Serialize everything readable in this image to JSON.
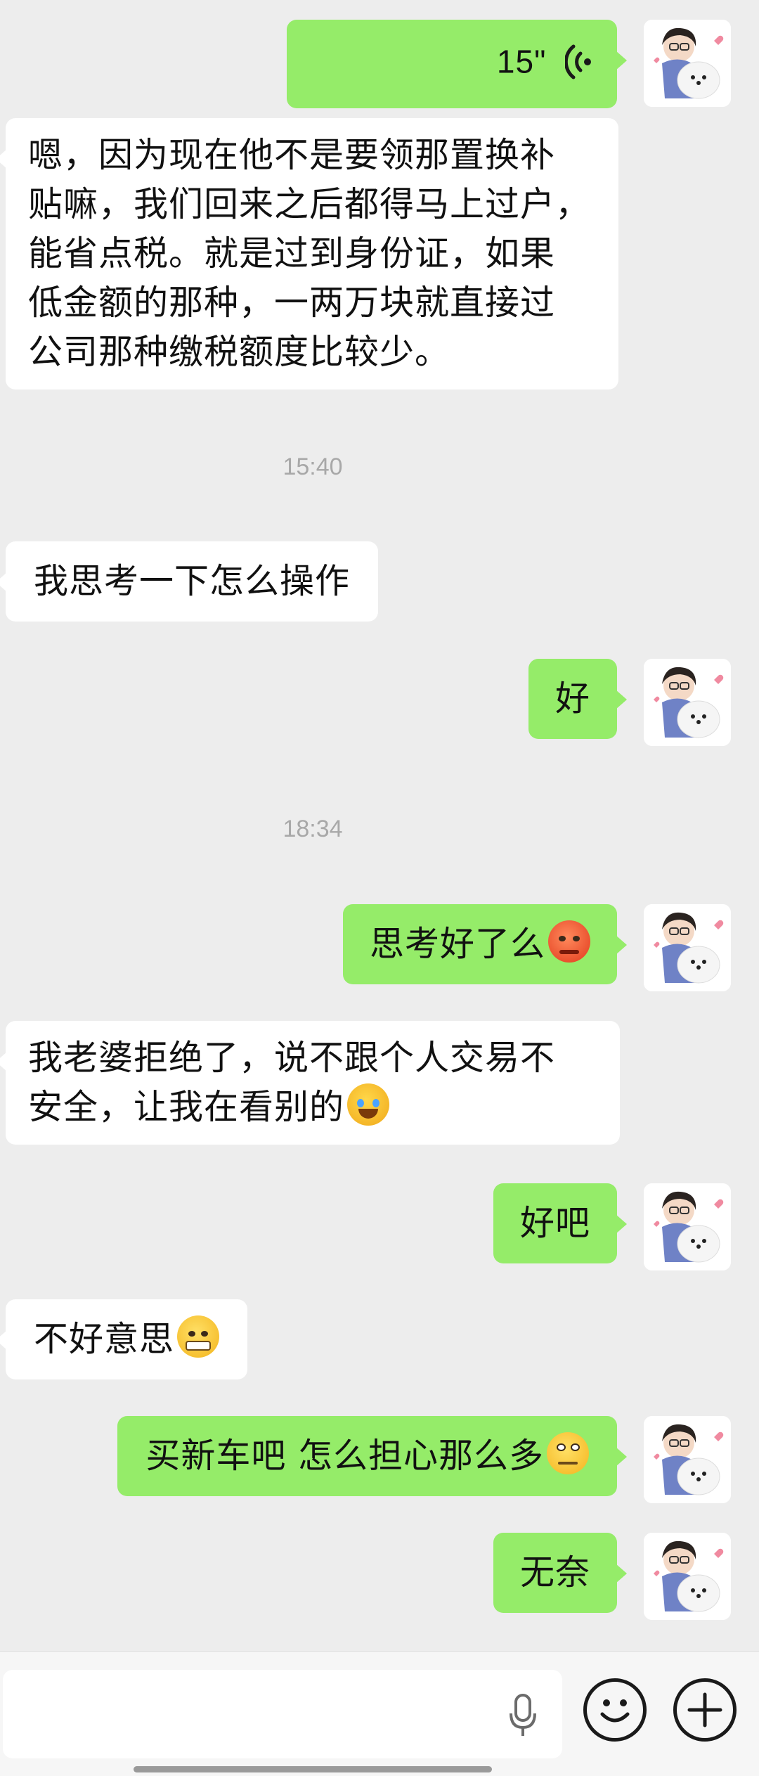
{
  "messages": [
    {
      "side": "out",
      "type": "voice",
      "duration": "15\""
    },
    {
      "side": "in",
      "text": [
        "嗯，因为现在他不是要领那置换补",
        "贴嘛，我们回来之后都得马上过户，",
        "能省点税。就是过到身份证，如果",
        "低金额的那种，一两万块就直接过",
        "公司那种缴税额度比较少。"
      ]
    },
    {
      "side": "time",
      "text": "15:40"
    },
    {
      "side": "in",
      "text": "我思考一下怎么操作"
    },
    {
      "side": "out",
      "text": "好"
    },
    {
      "side": "time",
      "text": "18:34"
    },
    {
      "side": "out",
      "text": "思考好了么",
      "emoji": "angry-sweat-emoji"
    },
    {
      "side": "in",
      "text": [
        "我老婆拒绝了，说不跟个人交易不",
        "安全，让我在看别的"
      ],
      "emoji": "crying-laughing-emoji"
    },
    {
      "side": "out",
      "text": "好吧"
    },
    {
      "side": "in",
      "text": "不好意思",
      "emoji": "grimacing-emoji"
    },
    {
      "side": "out",
      "text": "买新车吧 怎么担心那么多",
      "emoji": "eye-roll-sweat-emoji"
    },
    {
      "side": "out",
      "text": "无奈"
    }
  ],
  "input_bar": {
    "placeholder": "",
    "icons": [
      "microphone-icon",
      "emoji-icon",
      "add-icon"
    ]
  },
  "colors": {
    "background": "#ededed",
    "outgoing_bubble": "#95ec69",
    "incoming_bubble": "#ffffff",
    "timestamp": "#a8a8a8"
  }
}
